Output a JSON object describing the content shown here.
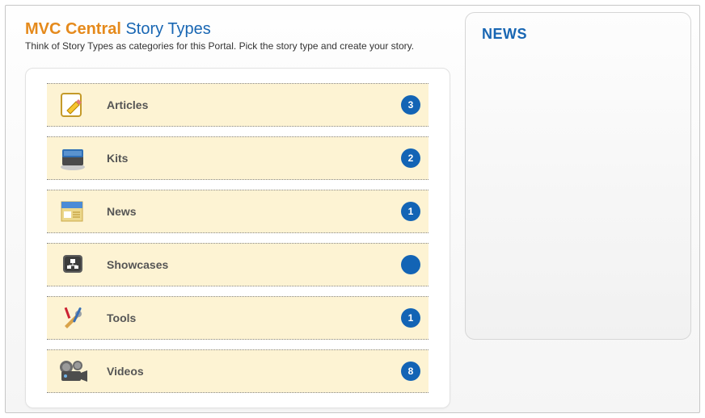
{
  "header": {
    "brand": "MVC Central",
    "section": "Story Types",
    "subtitle": "Think of Story Types as categories for this Portal. Pick the story type and create your story."
  },
  "storyTypes": [
    {
      "icon": "article-icon",
      "label": "Articles",
      "count": "3"
    },
    {
      "icon": "kit-icon",
      "label": "Kits",
      "count": "2"
    },
    {
      "icon": "news-icon",
      "label": "News",
      "count": "1"
    },
    {
      "icon": "showcase-icon",
      "label": "Showcases",
      "count": ""
    },
    {
      "icon": "tools-icon",
      "label": "Tools",
      "count": "1"
    },
    {
      "icon": "videos-icon",
      "label": "Videos",
      "count": "8"
    }
  ],
  "sidebar": {
    "newsTitle": "NEWS"
  }
}
